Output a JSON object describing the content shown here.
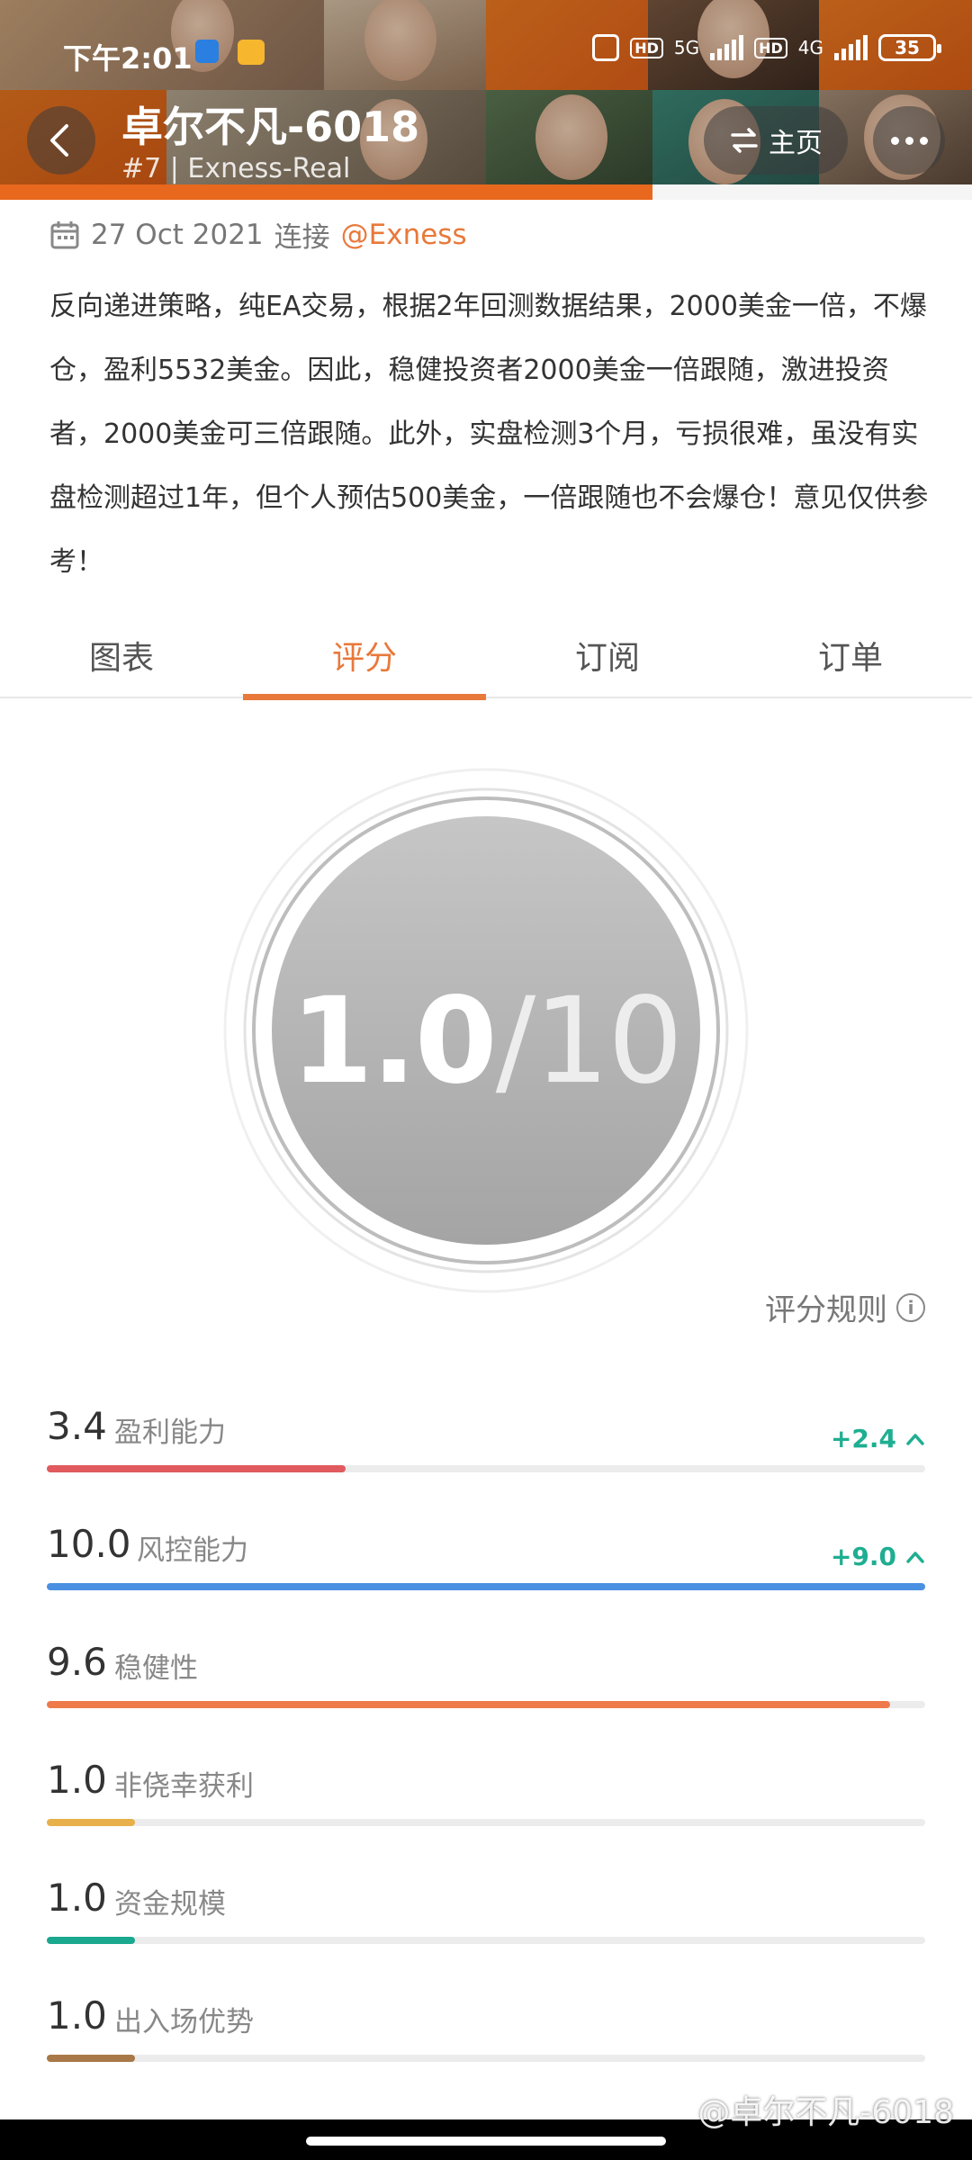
{
  "status_bar": {
    "time": "下午2:01",
    "network_5g": "5G",
    "network_4g": "4G",
    "hd1": "HD",
    "hd2": "HD",
    "battery": "35"
  },
  "header": {
    "title": "卓尔不凡-6018",
    "subtitle": "#7 | Exness-Real",
    "home_label": "主页"
  },
  "date_line": {
    "date": "27 Oct 2021",
    "connect": "连接",
    "broker": "@Exness"
  },
  "description": "反向递进策略，纯EA交易，根据2年回测数据结果，2000美金一倍，不爆仓，盈利5532美金。因此，稳健投资者2000美金一倍跟随，激进投资者，2000美金可三倍跟随。此外，实盘检测3个月，亏损很难，虽没有实盘检测超过1年，但个人预估500美金，一倍跟随也不会爆仓！意见仅供参考！",
  "tabs": [
    {
      "label": "图表"
    },
    {
      "label": "评分"
    },
    {
      "label": "订阅"
    },
    {
      "label": "订单"
    }
  ],
  "active_tab": "评分",
  "score": {
    "value": "1.0",
    "denominator": "/10"
  },
  "rules_label": "评分规则",
  "metrics": [
    {
      "value": "3.4",
      "label": "盈利能力",
      "change": "+2.4",
      "score": 3.4,
      "color": "#e05a5e"
    },
    {
      "value": "10.0",
      "label": "风控能力",
      "change": "+9.0",
      "score": 10.0,
      "color": "#4a90e2"
    },
    {
      "value": "9.6",
      "label": "稳健性",
      "change": "",
      "score": 9.6,
      "color": "#ee7a4c"
    },
    {
      "value": "1.0",
      "label": "非侥幸获利",
      "change": "",
      "score": 1.0,
      "color": "#e8b04a"
    },
    {
      "value": "1.0",
      "label": "资金规模",
      "change": "",
      "score": 1.0,
      "color": "#1aa88f"
    },
    {
      "value": "1.0",
      "label": "出入场优势",
      "change": "",
      "score": 1.0,
      "color": "#a87848"
    }
  ],
  "watermark": "@卓尔不凡-6018",
  "colors": {
    "accent": "#e8793a",
    "positive": "#1fae91"
  }
}
